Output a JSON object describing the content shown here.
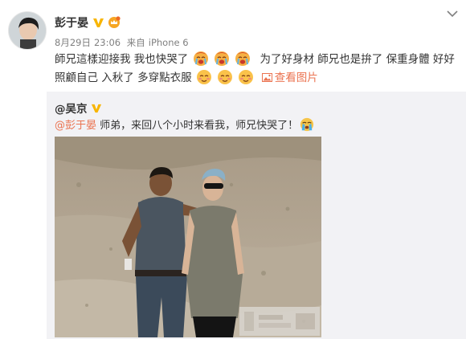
{
  "user": {
    "name": "彭于晏"
  },
  "meta": {
    "date": "8月29日",
    "time": "23:06",
    "source_prefix": "来自",
    "source": "iPhone 6"
  },
  "post": {
    "line1_a": "師兄這樣迎接我 我也快哭了",
    "line1_b": "为了好身材 師兄也是拚了 保重身體 好好",
    "line2_a": "照顧自己 入秋了 多穿點衣服",
    "view_pic": "查看图片"
  },
  "repost": {
    "author": "@吴京",
    "mention": "@彭于晏",
    "text": " 师弟，来回八个小时来看我，师兄快哭了！"
  },
  "colors": {
    "accent": "#eb7350",
    "verified": "#f8b500",
    "repost_bg": "#f2f2f5",
    "meta": "#808080"
  },
  "icons": {
    "menu": "chevron-down-icon",
    "verified": "verified-v-icon",
    "vip": "vip-crown-icon",
    "crying": "crying-emoji-icon",
    "shy": "blushing-emoji-icon",
    "picture": "picture-icon",
    "tears": "tears-emoji-icon"
  }
}
